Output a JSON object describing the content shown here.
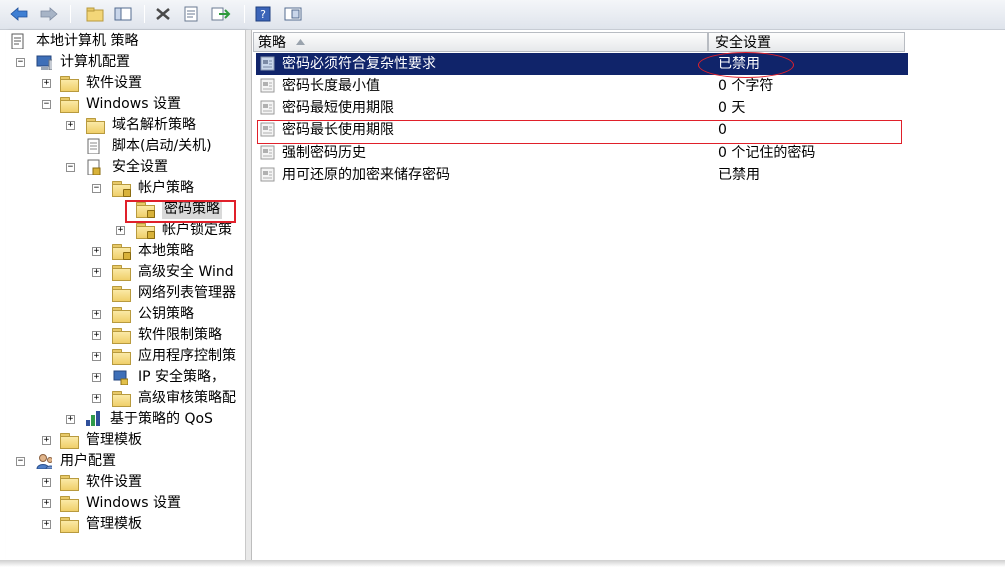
{
  "toolbar": {
    "buttons": [
      "back-arrow-icon",
      "forward-arrow-icon",
      "up-folder-icon",
      "show-hide-tree-icon",
      "delete-icon",
      "properties-icon",
      "export-list-icon",
      "help-icon",
      "view-icon"
    ]
  },
  "tree": {
    "root": "本地计算机 策略",
    "computer_config": "计算机配置",
    "software_settings": "软件设置",
    "windows_settings": "Windows 设置",
    "name_resolution": "域名解析策略",
    "scripts": "脚本(启动/关机)",
    "security_settings": "安全设置",
    "account_policies": "帐户策略",
    "password_policy": "密码策略",
    "lockout_policy": "帐户锁定策",
    "local_policies": "本地策略",
    "advanced_firewall": "高级安全 Wind",
    "network_list": "网络列表管理器",
    "public_key": "公钥策略",
    "software_restriction": "软件限制策略",
    "app_control": "应用程序控制策",
    "ip_security": "IP 安全策略，",
    "advanced_audit": "高级审核策略配",
    "qos": "基于策略的 QoS",
    "admin_templates": "管理模板",
    "user_config": "用户配置",
    "user_software_settings": "软件设置",
    "user_windows_settings": "Windows 设置",
    "user_admin_templates": "管理模板"
  },
  "list": {
    "col_policy": "策略",
    "col_setting": "安全设置",
    "rows": [
      {
        "policy": "密码必须符合复杂性要求",
        "setting": "已禁用"
      },
      {
        "policy": "密码长度最小值",
        "setting": "0 个字符"
      },
      {
        "policy": "密码最短使用期限",
        "setting": "0 天"
      },
      {
        "policy": "密码最长使用期限",
        "setting": "0"
      },
      {
        "policy": "强制密码历史",
        "setting": "0 个记住的密码"
      },
      {
        "policy": "用可还原的加密来储存密码",
        "setting": "已禁用"
      }
    ]
  },
  "colors": {
    "selection": "#10246a",
    "annotation": "#e0202a"
  }
}
